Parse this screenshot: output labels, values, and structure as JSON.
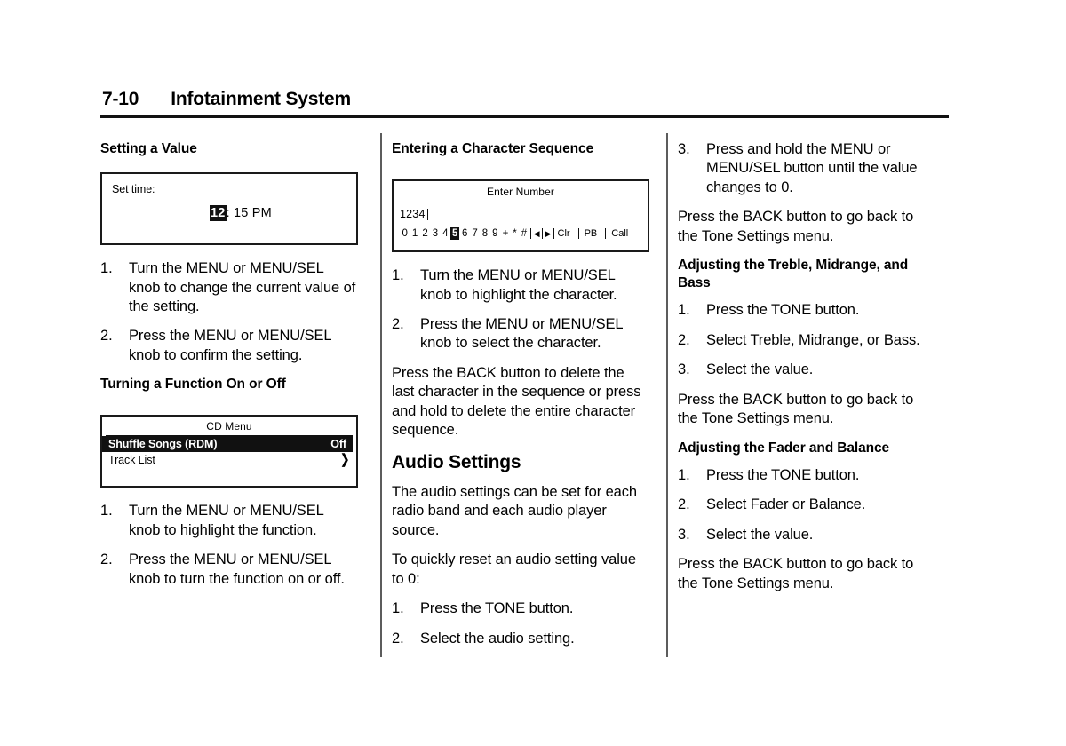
{
  "header": {
    "folio": "7-10",
    "chapter": "Infotainment System"
  },
  "columns": {
    "col1": {
      "heading_setting_a_value": "Setting a Value",
      "screen_set_time": {
        "label": "Set time:",
        "hour_highlighted": "12",
        "rest": ": 15 PM"
      },
      "steps_setting_a_value": [
        {
          "num": "1.",
          "text": "Turn the MENU or MENU/SEL knob to change the current value of the setting."
        },
        {
          "num": "2.",
          "text": "Press the MENU or MENU/SEL knob to confirm the setting."
        }
      ],
      "heading_turning_function": "Turning a Function On or Off",
      "screen_cd_menu": {
        "title": "CD Menu",
        "rows": [
          {
            "label": "Shuffle Songs (RDM)",
            "value": "Off",
            "selected": true
          },
          {
            "label": "Track List",
            "value": "❯",
            "selected": false
          }
        ]
      },
      "steps_turning_function": [
        {
          "num": "1.",
          "text": "Turn the MENU or MENU/SEL knob to highlight the function."
        },
        {
          "num": "2.",
          "text": "Press the MENU or MENU/SEL knob to turn the function on or off."
        }
      ]
    },
    "col2": {
      "heading_entering_sequence": "Entering a Character Sequence",
      "screen_enter_number": {
        "title": "Enter Number",
        "entry_value": "1234",
        "keys": [
          "0",
          "1",
          "2",
          "3",
          "4",
          "5",
          "6",
          "7",
          "8",
          "9",
          "+",
          "*",
          "#"
        ],
        "selected_key": "5",
        "arrow_left": "◀",
        "arrow_right": "▶",
        "action_clear": "Clr",
        "action_pb": "PB",
        "action_call": "Call"
      },
      "steps_entering_sequence": [
        {
          "num": "1.",
          "text": "Turn the MENU or MENU/SEL knob to highlight the character."
        },
        {
          "num": "2.",
          "text": "Press the MENU or MENU/SEL knob to select the character."
        }
      ],
      "para_back_delete": "Press the BACK button to delete the last character in the sequence or press and hold to delete the entire character sequence.",
      "heading_audio_settings": "Audio Settings",
      "para_audio_settings": "The audio settings can be set for each radio band and each audio player source.",
      "para_reset_intro": "To quickly reset an audio setting value to 0:",
      "steps_reset": [
        {
          "num": "1.",
          "text": "Press the TONE button."
        },
        {
          "num": "2.",
          "text": "Select the audio setting."
        }
      ]
    },
    "col3": {
      "steps_reset_continued": [
        {
          "num": "3.",
          "text": "Press and hold the MENU or MENU/SEL button until the value changes to 0."
        }
      ],
      "para_back_tone_1": "Press the BACK button to go back to the Tone Settings menu.",
      "heading_treble": "Adjusting the Treble, Midrange, and Bass",
      "steps_treble": [
        {
          "num": "1.",
          "text": "Press the TONE button."
        },
        {
          "num": "2.",
          "text": "Select Treble, Midrange, or Bass."
        },
        {
          "num": "3.",
          "text": "Select the value."
        }
      ],
      "para_back_tone_2": "Press the BACK button to go back to the Tone Settings menu.",
      "heading_fader": "Adjusting the Fader and Balance",
      "steps_fader": [
        {
          "num": "1.",
          "text": "Press the TONE button."
        },
        {
          "num": "2.",
          "text": "Select Fader or Balance."
        },
        {
          "num": "3.",
          "text": "Select the value."
        }
      ],
      "para_back_tone_3": "Press the BACK button to go back to the Tone Settings menu."
    }
  }
}
